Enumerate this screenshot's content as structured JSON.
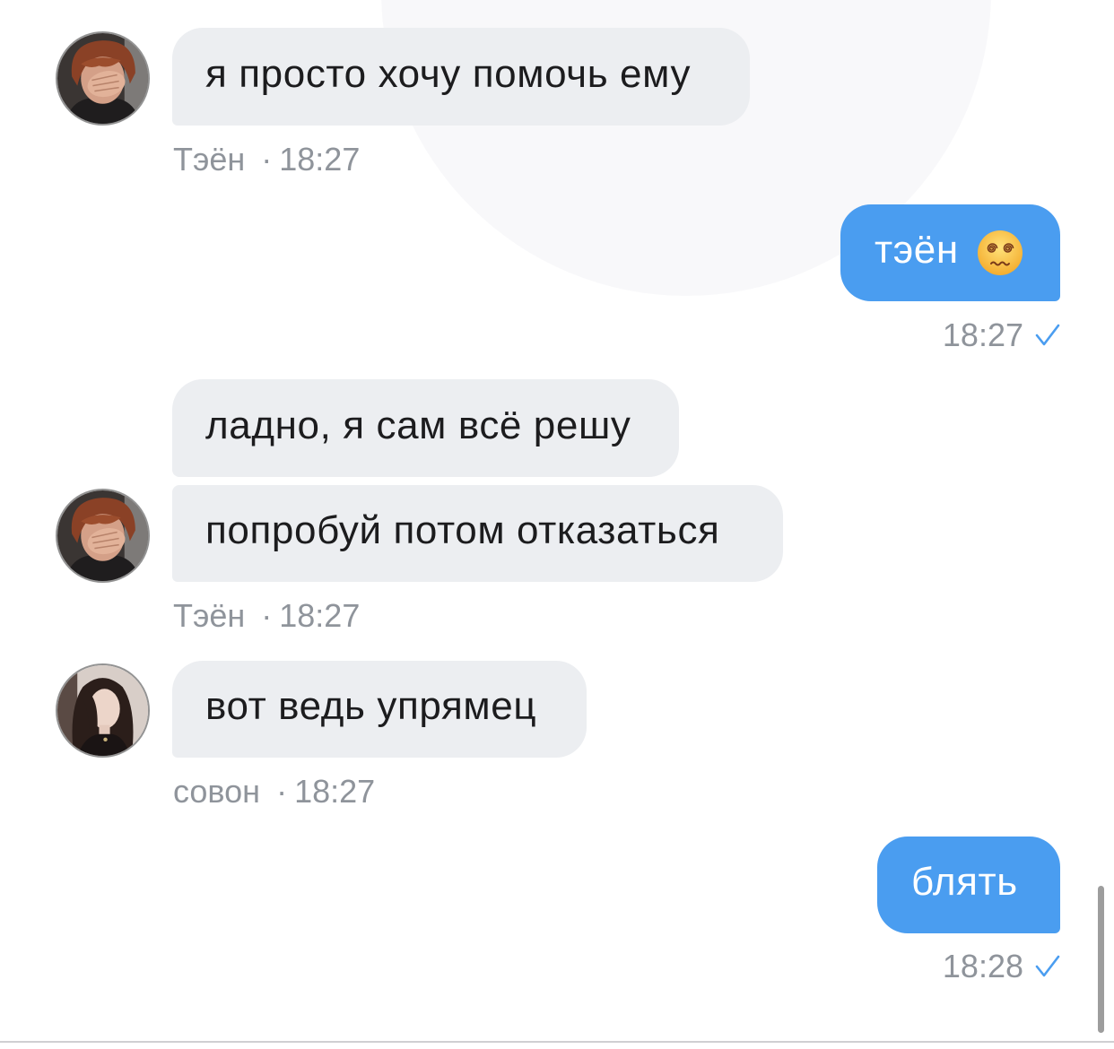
{
  "chat": {
    "meta_separator": "·",
    "groups": [
      {
        "author": "Тэён",
        "time": "18:27",
        "bubbles": [
          {
            "text": "я просто хочу помочь ему"
          }
        ]
      },
      {
        "time": "18:27",
        "status_icon": "read-check-icon",
        "bubbles": [
          {
            "text": "тэён",
            "emoji_icon": "face-with-spiral-eyes-icon"
          }
        ]
      },
      {
        "author": "Тэён",
        "time": "18:27",
        "bubbles": [
          {
            "text": "ладно, я сам всё решу"
          },
          {
            "text": "попробуй потом отказаться"
          }
        ]
      },
      {
        "author": "совон",
        "time": "18:27",
        "bubbles": [
          {
            "text": "вот ведь упрямец"
          }
        ]
      },
      {
        "time": "18:28",
        "status_icon": "read-check-icon",
        "bubbles": [
          {
            "text": "блять"
          }
        ]
      }
    ]
  },
  "theme": {
    "incoming_bubble": "#eceef1",
    "outgoing_bubble": "#4a9df0",
    "meta_text": "#8f949b",
    "check": "#4a9df0",
    "incoming_text": "#1c1c1e",
    "outgoing_text": "#ffffff"
  }
}
